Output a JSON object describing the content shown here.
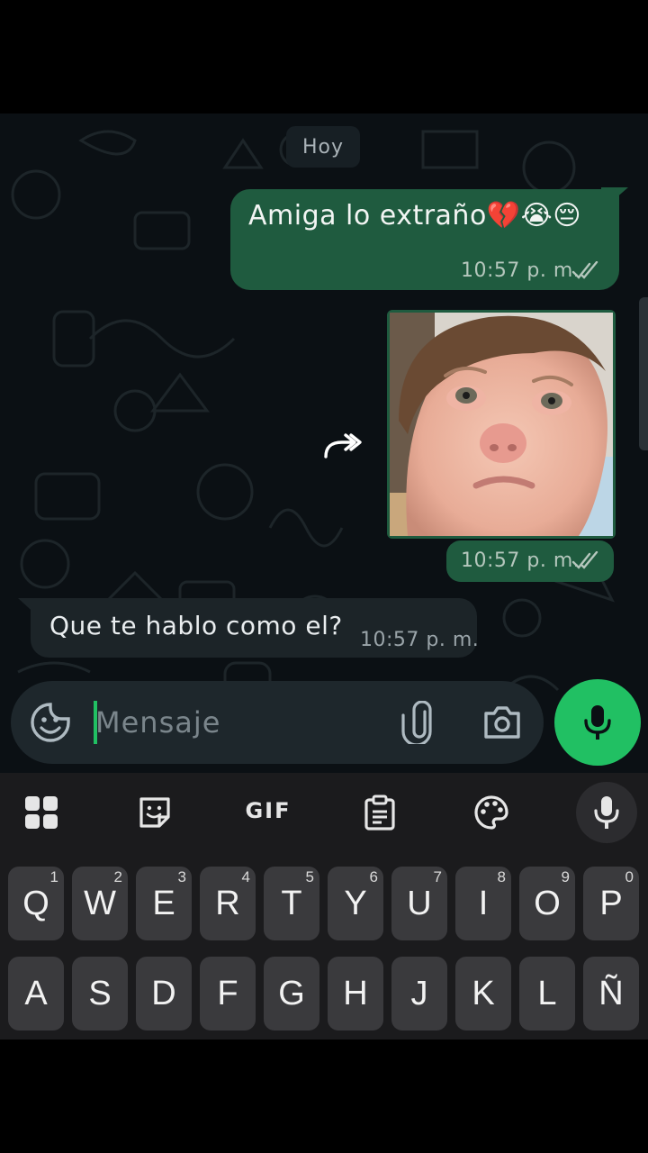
{
  "chat": {
    "date_label": "Hoy",
    "messages": [
      {
        "direction": "out",
        "text": "Amiga lo extraño💔😭😔",
        "time": "10:57 p. m.",
        "status": "read"
      },
      {
        "direction": "out",
        "type": "image",
        "image_desc": "crying-baby-photo",
        "time": "10:57 p. m.",
        "status": "read"
      },
      {
        "direction": "in",
        "text": "Que te hablo como el?",
        "time": "10:57 p. m."
      }
    ]
  },
  "input": {
    "placeholder": "Mensaje",
    "value": ""
  },
  "keyboard": {
    "toolbar": {
      "gif_label": "GIF"
    },
    "row1": [
      {
        "k": "Q",
        "h": "1"
      },
      {
        "k": "W",
        "h": "2"
      },
      {
        "k": "E",
        "h": "3"
      },
      {
        "k": "R",
        "h": "4"
      },
      {
        "k": "T",
        "h": "5"
      },
      {
        "k": "Y",
        "h": "6"
      },
      {
        "k": "U",
        "h": "7"
      },
      {
        "k": "I",
        "h": "8"
      },
      {
        "k": "O",
        "h": "9"
      },
      {
        "k": "P",
        "h": "0"
      }
    ],
    "row2": [
      {
        "k": "A"
      },
      {
        "k": "S"
      },
      {
        "k": "D"
      },
      {
        "k": "F"
      },
      {
        "k": "G"
      },
      {
        "k": "H"
      },
      {
        "k": "J"
      },
      {
        "k": "K"
      },
      {
        "k": "L"
      },
      {
        "k": "Ñ"
      }
    ]
  },
  "colors": {
    "outgoing_bubble": "#1f5b3f",
    "incoming_bubble": "#1c2428",
    "accent_green": "#21c063",
    "chat_bg": "#0b1014",
    "keyboard_bg": "#1b1b1d",
    "key_bg": "#3a3a3d"
  }
}
